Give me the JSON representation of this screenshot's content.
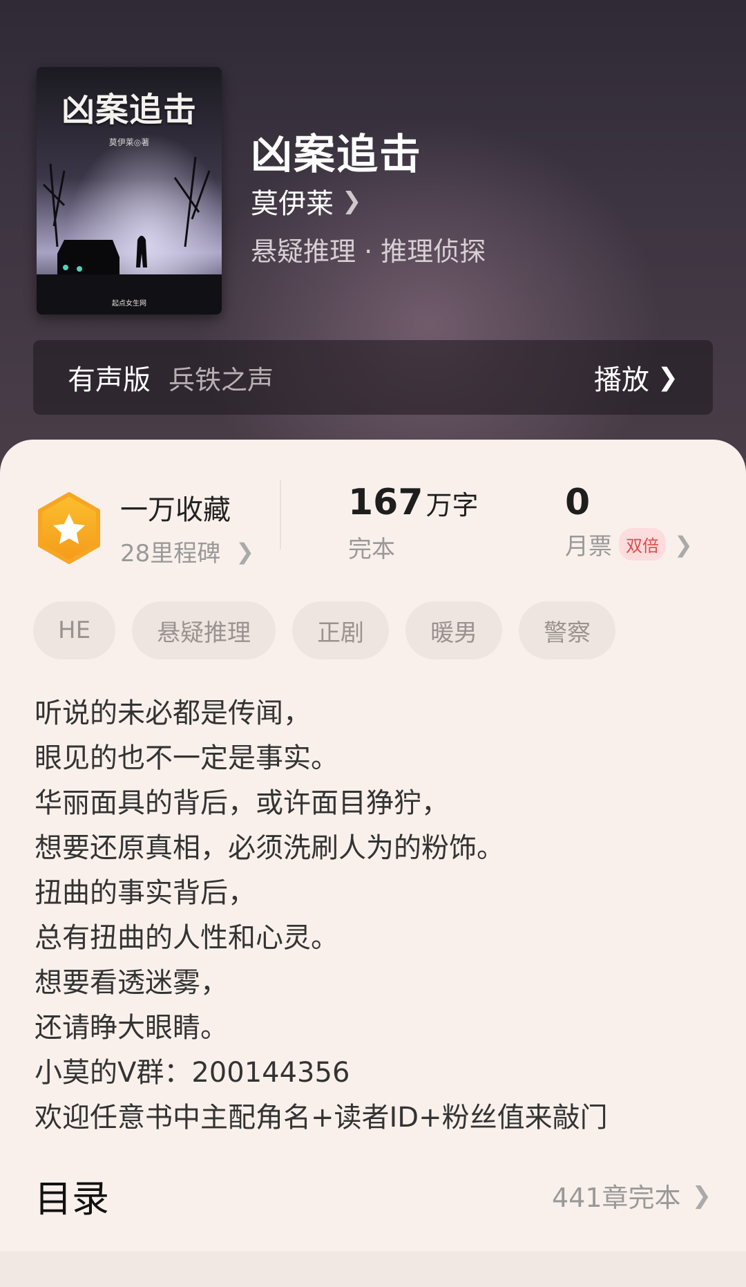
{
  "book": {
    "title": "凶案追击",
    "author": "莫伊莱",
    "genre": "悬疑推理 · 推理侦探",
    "cover": {
      "title": "凶案追击",
      "author": "莫伊莱◎著",
      "publisher": "起点女生网"
    }
  },
  "audio": {
    "label": "有声版",
    "narrator": "兵铁之声",
    "play_label": "播放"
  },
  "stats": {
    "favorites": {
      "title": "一万收藏",
      "milestone": "28里程碑"
    },
    "words": {
      "number": "167",
      "unit": "万字",
      "status": "完本"
    },
    "monthly_ticket": {
      "number": "0",
      "label": "月票",
      "badge": "双倍"
    }
  },
  "tags": [
    "HE",
    "悬疑推理",
    "正剧",
    "暖男",
    "警察"
  ],
  "description": [
    "听说的未必都是传闻，",
    "眼见的也不一定是事实。",
    "华丽面具的背后，或许面目狰狞，",
    "想要还原真相，必须洗刷人为的粉饰。",
    "扭曲的事实背后，",
    "总有扭曲的人性和心灵。",
    "想要看透迷雾，",
    "还请睁大眼睛。",
    "小莫的V群：200144356",
    "欢迎任意书中主配角名+读者ID+粉丝值来敲门"
  ],
  "toc": {
    "title": "目录",
    "summary": "441章完本"
  },
  "colors": {
    "accent_orange": "#f7a21b",
    "badge_red": "#e0484c",
    "sheet_bg": "#f9f0eb"
  },
  "icons": {
    "favorites": "star-hexagon-icon",
    "chevron": "chevron-right-icon"
  }
}
